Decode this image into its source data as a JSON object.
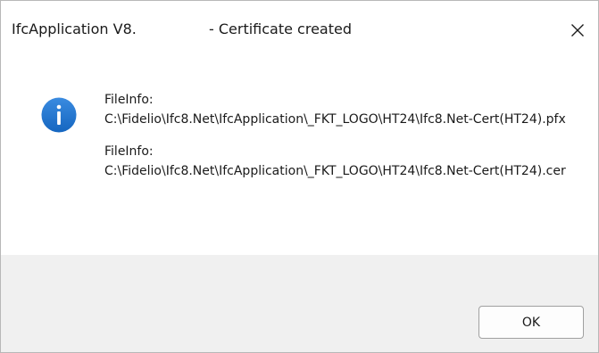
{
  "dialog": {
    "title_app": "IfcApplication V8.",
    "title_message": "- Certificate created",
    "close_symbol": "✕",
    "icon": "info-icon",
    "accent_color": "#1f73d3",
    "messages": [
      {
        "label": "FileInfo:",
        "path": "C:\\Fidelio\\Ifc8.Net\\IfcApplication\\_FKT_LOGO\\HT24\\Ifc8.Net-Cert(HT24).pfx"
      },
      {
        "label": "FileInfo:",
        "path": "C:\\Fidelio\\Ifc8.Net\\IfcApplication\\_FKT_LOGO\\HT24\\Ifc8.Net-Cert(HT24).cer"
      }
    ],
    "ok_label": "OK"
  }
}
